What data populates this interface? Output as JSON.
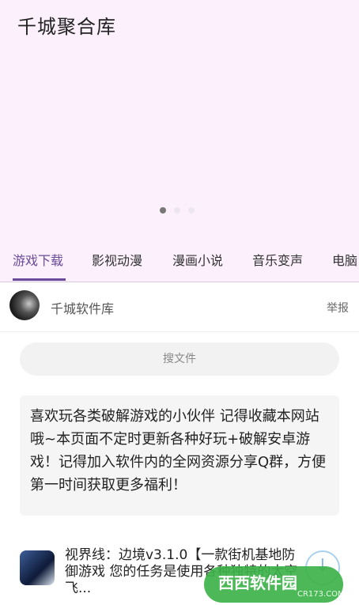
{
  "header": {
    "title": "千城聚合库"
  },
  "carousel": {
    "count": 3,
    "active": 0
  },
  "tabs": [
    {
      "label": "游戏下载",
      "active": true
    },
    {
      "label": "影视动漫"
    },
    {
      "label": "漫画小说"
    },
    {
      "label": "音乐变声"
    },
    {
      "label": "电脑"
    }
  ],
  "user": {
    "name": "千城软件库",
    "report_label": "举报"
  },
  "search": {
    "placeholder": "搜文件"
  },
  "notice": {
    "text": "喜欢玩各类破解游戏的小伙伴 记得收藏本网站哦~本页面不定时更新各种好玩+破解安卓游戏！记得加入软件内的全网资源分享Q群，方便第一时间获取更多福利！"
  },
  "app_item": {
    "description": "视界线：边境v3.1.0【一款街机基地防御游戏 您的任务是使用各种独特的太空飞..."
  },
  "watermark": {
    "main": "西西软件园",
    "sub": "CR173.COM"
  },
  "colors": {
    "header_bg": "#fbf0fb",
    "accent": "#6a4a9a",
    "watermark": "#3db34a"
  }
}
